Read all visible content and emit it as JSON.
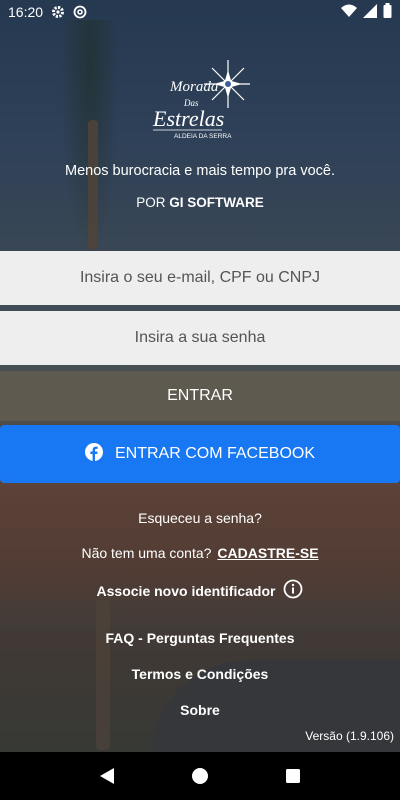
{
  "status_bar": {
    "time": "16:20",
    "icons_left": [
      "gear-icon",
      "at-sign-icon"
    ],
    "icons_right": [
      "wifi-icon",
      "signal-icon",
      "battery-icon"
    ]
  },
  "logo": {
    "line1": "Morada",
    "line2": "Das",
    "line3": "Estrelas",
    "line4": "ALDEIA DA SERRA"
  },
  "tagline": "Menos burocracia e mais tempo pra você.",
  "byline": {
    "prefix": "POR",
    "brand": "GI SOFTWARE"
  },
  "form": {
    "email_placeholder": "Insira o seu e-mail, CPF ou CNPJ",
    "password_placeholder": "Insira a sua senha",
    "enter_label": "ENTRAR",
    "facebook_label": "ENTRAR COM FACEBOOK"
  },
  "links": {
    "forgot": "Esqueceu a senha?",
    "no_account": "Não tem uma conta?",
    "register": "CADASTRE-SE",
    "associate": "Associe novo identificador",
    "faq": "FAQ - Perguntas Frequentes",
    "terms": "Termos e Condições",
    "about": "Sobre"
  },
  "version": "Versão (1.9.106)",
  "colors": {
    "facebook": "#1877f2",
    "enter_button": "#5f5a4f",
    "input_bg": "#eeeeee"
  }
}
